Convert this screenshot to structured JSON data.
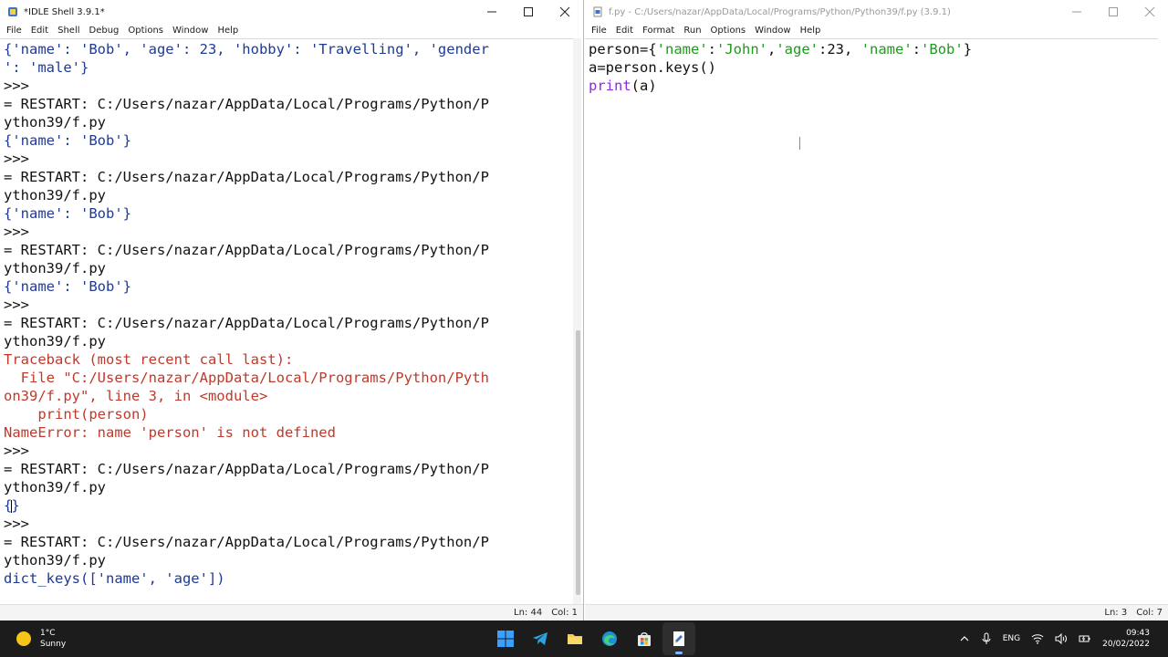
{
  "shell": {
    "title": "*IDLE Shell 3.9.1*",
    "menu": [
      "File",
      "Edit",
      "Shell",
      "Debug",
      "Options",
      "Window",
      "Help"
    ],
    "status": {
      "ln": "Ln: 44",
      "col": "Col: 1"
    },
    "lines": [
      {
        "text": "{'name': 'Bob', 'age': 23, 'hobby': 'Travelling', 'gender",
        "cls": "out"
      },
      {
        "text": "': 'male'}",
        "cls": "out"
      },
      {
        "text": ">>> ",
        "cls": "def"
      },
      {
        "text": "= RESTART: C:/Users/nazar/AppData/Local/Programs/Python/P",
        "cls": "def"
      },
      {
        "text": "ython39/f.py",
        "cls": "def"
      },
      {
        "text": "{'name': 'Bob'}",
        "cls": "out"
      },
      {
        "text": ">>> ",
        "cls": "def"
      },
      {
        "text": "= RESTART: C:/Users/nazar/AppData/Local/Programs/Python/P",
        "cls": "def"
      },
      {
        "text": "ython39/f.py",
        "cls": "def"
      },
      {
        "text": "{'name': 'Bob'}",
        "cls": "out"
      },
      {
        "text": ">>> ",
        "cls": "def"
      },
      {
        "text": "= RESTART: C:/Users/nazar/AppData/Local/Programs/Python/P",
        "cls": "def"
      },
      {
        "text": "ython39/f.py",
        "cls": "def"
      },
      {
        "text": "{'name': 'Bob'}",
        "cls": "out"
      },
      {
        "text": ">>> ",
        "cls": "def"
      },
      {
        "text": "= RESTART: C:/Users/nazar/AppData/Local/Programs/Python/P",
        "cls": "def"
      },
      {
        "text": "ython39/f.py",
        "cls": "def"
      },
      {
        "text": "Traceback (most recent call last):",
        "cls": "err"
      },
      {
        "text": "  File \"C:/Users/nazar/AppData/Local/Programs/Python/Pyth",
        "cls": "err"
      },
      {
        "text": "on39/f.py\", line 3, in <module>",
        "cls": "err"
      },
      {
        "text": "    print(person)",
        "cls": "err"
      },
      {
        "text": "NameError: name 'person' is not defined",
        "cls": "err"
      },
      {
        "text": ">>> ",
        "cls": "def"
      },
      {
        "text": "= RESTART: C:/Users/nazar/AppData/Local/Programs/Python/P",
        "cls": "def"
      },
      {
        "text": "ython39/f.py",
        "cls": "def"
      },
      {
        "text": "{}",
        "cls": "out",
        "caret_after": 1
      },
      {
        "text": ">>> ",
        "cls": "def"
      },
      {
        "text": "= RESTART: C:/Users/nazar/AppData/Local/Programs/Python/P",
        "cls": "def"
      },
      {
        "text": "ython39/f.py",
        "cls": "def"
      },
      {
        "text": "dict_keys(['name', 'age'])",
        "cls": "out"
      }
    ]
  },
  "editor": {
    "title": "f.py - C:/Users/nazar/AppData/Local/Programs/Python/Python39/f.py (3.9.1)",
    "menu": [
      "File",
      "Edit",
      "Format",
      "Run",
      "Options",
      "Window",
      "Help"
    ],
    "status": {
      "ln": "Ln: 3",
      "col": "Col: 7"
    },
    "lines": [
      [
        {
          "t": "person={",
          "c": "def"
        },
        {
          "t": "'name'",
          "c": "str"
        },
        {
          "t": ":",
          "c": "def"
        },
        {
          "t": "'John'",
          "c": "str"
        },
        {
          "t": ",",
          "c": "def"
        },
        {
          "t": "'age'",
          "c": "str"
        },
        {
          "t": ":23, ",
          "c": "def"
        },
        {
          "t": "'name'",
          "c": "str"
        },
        {
          "t": ":",
          "c": "def"
        },
        {
          "t": "'Bob'",
          "c": "str"
        },
        {
          "t": "}",
          "c": "def"
        }
      ],
      [
        {
          "t": "a=person.keys()",
          "c": "def"
        }
      ],
      [
        {
          "t": "print",
          "c": "kw"
        },
        {
          "t": "(a)",
          "c": "def"
        }
      ]
    ]
  },
  "taskbar": {
    "weather": {
      "temp": "1°C",
      "condition": "Sunny"
    },
    "apps": [
      {
        "icon": "windows-start-icon"
      },
      {
        "icon": "telegram-icon"
      },
      {
        "icon": "file-explorer-icon"
      },
      {
        "icon": "edge-browser-icon"
      },
      {
        "icon": "microsoft-store-icon"
      },
      {
        "icon": "idle-python-icon",
        "active": true
      }
    ],
    "tray": {
      "language": "ENG",
      "time": "09:43",
      "date": "20/02/2022"
    }
  }
}
